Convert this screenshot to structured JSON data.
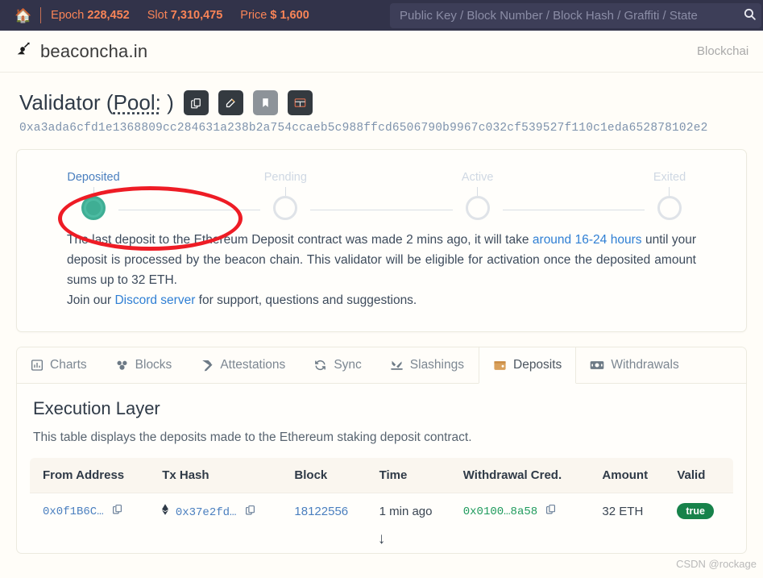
{
  "topbar": {
    "home_icon": "home-icon",
    "stats": [
      {
        "label": "Epoch",
        "value": "228,452"
      },
      {
        "label": "Slot",
        "value": "7,310,475"
      },
      {
        "label": "Price",
        "value": "$ 1,600"
      }
    ],
    "search_placeholder": "Public Key / Block Number / Block Hash / Graffiti / State",
    "search_icon": "search-icon",
    "bg_color": "#32334a",
    "accent_color": "#f98457"
  },
  "navbar": {
    "logo_icon": "beaconchain-logo-icon",
    "brand": "beaconcha.in",
    "right_item": "Blockchain"
  },
  "page": {
    "title_prefix": "Validator (",
    "title_pool": "Pool:",
    "title_suffix": " )",
    "pubkey": "0xa3ada6cfd1e1368809cc284631a238b2a754ccaeb5c988ffcd6506790b9967c032cf539527f110c1eda652878102e2",
    "actions": [
      {
        "name": "copy-button",
        "glyph": "❐"
      },
      {
        "name": "edit-button",
        "glyph": "✎"
      },
      {
        "name": "bookmark-button",
        "glyph": "⚑"
      },
      {
        "name": "table-view-button",
        "glyph": "▦"
      }
    ]
  },
  "status": {
    "steps": [
      {
        "label": "Deposited",
        "state": "done"
      },
      {
        "label": "Pending",
        "state": "todo"
      },
      {
        "label": "Active",
        "state": "todo"
      },
      {
        "label": "Exited",
        "state": "todo"
      }
    ],
    "active_color": "#3fae94",
    "paragraph_1_a": "The last deposit to the Ethereum Deposit contract was made 2 mins ago, it will take ",
    "paragraph_1_link": "around 16-24 hours",
    "paragraph_1_b": " until your deposit is processed by the beacon chain. This validator will be eligible for activation once the deposited amount sums up to 32 ETH.",
    "paragraph_2_a": "Join our ",
    "paragraph_2_link": "Discord server",
    "paragraph_2_b": " for support, questions and suggestions."
  },
  "tabs": [
    {
      "label": "Charts",
      "icon": "bar-chart-icon",
      "active": false
    },
    {
      "label": "Blocks",
      "icon": "blocks-icon",
      "active": false
    },
    {
      "label": "Attestations",
      "icon": "attestations-icon",
      "active": false
    },
    {
      "label": "Sync",
      "icon": "sync-icon",
      "active": false
    },
    {
      "label": "Slashings",
      "icon": "slashings-icon",
      "active": false
    },
    {
      "label": "Deposits",
      "icon": "deposits-wallet-icon",
      "active": true
    },
    {
      "label": "Withdrawals",
      "icon": "withdrawals-cash-icon",
      "active": false
    }
  ],
  "panel": {
    "heading": "Execution Layer",
    "description": "This table displays the deposits made to the Ethereum staking deposit contract."
  },
  "table": {
    "columns": [
      "From Address",
      "Tx Hash",
      "Block",
      "Time",
      "Withdrawal Cred.",
      "Amount",
      "Valid"
    ],
    "rows": [
      {
        "from_address": "0x0f1B6C…",
        "tx_hash": "0x37e2fd…",
        "block": "18122556",
        "time": "1 min ago",
        "withdrawal_cred": "0x0100…8a58",
        "amount": "32 ETH",
        "valid": "true"
      }
    ]
  },
  "footer": {
    "scroll_icon": "down-arrow-icon",
    "watermark": "CSDN @rockage"
  }
}
